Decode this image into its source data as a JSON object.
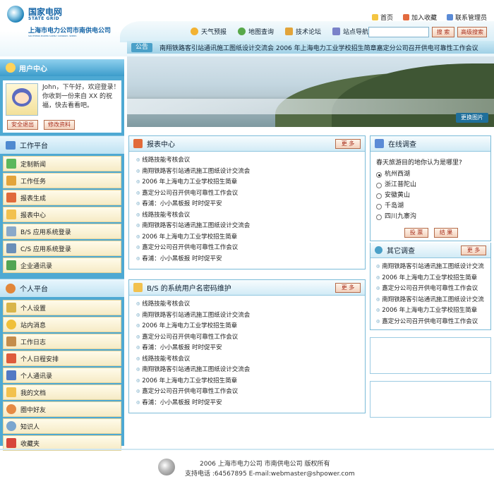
{
  "header": {
    "logo_cn": "国家电网",
    "logo_en": "STATE GRID",
    "company": "上海市电力公司市南供电公司",
    "company_en": "SOUTHERN POWER SUPPLY COMPANY, SMEPC",
    "toplinks": [
      "首页",
      "加入收藏",
      "联系管理员"
    ],
    "nav": [
      "天气预报",
      "地图查询",
      "技术论坛",
      "站点导航"
    ],
    "search_placeholder": "",
    "search_button": "搜 索",
    "advanced_search_button": "高级搜索",
    "ticker_tag": "公告",
    "ticker_text": "南翔铁路客引站通讯施工图纸设计交流会 2006 年上海电力工业学校招生简章嘉定分公司召开供电可靠性工作会议"
  },
  "user_center": {
    "title": "用户中心",
    "greeting": "John，下午好，欢迎登录！你收到一份来自 XX 的祝福，快去看看吧。",
    "logout_button": "安全退出",
    "edit_button": "修改资料"
  },
  "work_platform": {
    "title": "工作平台",
    "items": [
      "定制新闻",
      "工作任务",
      "报表生成",
      "报表中心",
      "B/S 应用系统登录",
      "C/S 应用系统登录",
      "企业通讯录"
    ]
  },
  "personal_platform": {
    "title": "个人平台",
    "items": [
      "个人设置",
      "站内消息",
      "工作日志",
      "个人日程安排",
      "个人通讯录",
      "我的文档",
      "圈中好友",
      "知识人",
      "收藏夹"
    ]
  },
  "banner": {
    "change_button": "更换图片"
  },
  "report_center": {
    "title": "报表中心",
    "more": "更 多",
    "items": [
      "线路技能考核会议",
      "南翔铁路客引站通讯施工图纸设计交流会",
      "2006 年上海电力工业学校招生简章",
      "嘉定分公司召开供电可靠性工作会议",
      "春浦：小小黑板报 时时促平安",
      "线路技能考核会议",
      "南翔铁路客引站通讯施工图纸设计交流会",
      "2006 年上海电力工业学校招生简章",
      "嘉定分公司召开供电可靠性工作会议",
      "春浦：小小黑板报 时时促平安"
    ]
  },
  "bs_password": {
    "title": "B/S 的系统用户名密码维护",
    "more": "更 多",
    "items": [
      "线路技能考核会议",
      "南翔铁路客引站通讯施工图纸设计交流会",
      "2006 年上海电力工业学校招生简章",
      "嘉定分公司召开供电可靠性工作会议",
      "春浦：小小黑板报 时时促平安",
      "线路技能考核会议",
      "南翔铁路客引站通讯施工图纸设计交流会",
      "2006 年上海电力工业学校招生简章",
      "嘉定分公司召开供电可靠性工作会议",
      "春浦：小小黑板报 时时促平安"
    ]
  },
  "survey": {
    "title": "在线调查",
    "question": "春天旅游目的地你认为是哪里?",
    "options": [
      "杭州西湖",
      "浙江普陀山",
      "安徽黄山",
      "千岛湖",
      "四川九寨沟"
    ],
    "selected": "杭州西湖",
    "vote_button": "投 票",
    "result_button": "结 果"
  },
  "other_survey": {
    "title": "其它调查",
    "more": "更 多",
    "items": [
      "南翔铁路客引站通讯施工图纸设计交流",
      "2006 年上海电力工业学校招生简章",
      "嘉定分公司召开供电可靠性工作会议",
      "南翔铁路客引站通讯施工图纸设计交流",
      "2006 年上海电力工业学校招生简章",
      "嘉定分公司召开供电可靠性工作会议"
    ]
  },
  "footer": {
    "copyright": "2006 上海市电力公司 市南供电公司 版权所有",
    "contact": "支持电话 :64567895 E-mail:webmaster@shpower.com"
  },
  "colors": {
    "brand_blue": "#1565a7",
    "sidebar_blue": "#4ea9d3",
    "button_red": "#a8301e"
  }
}
